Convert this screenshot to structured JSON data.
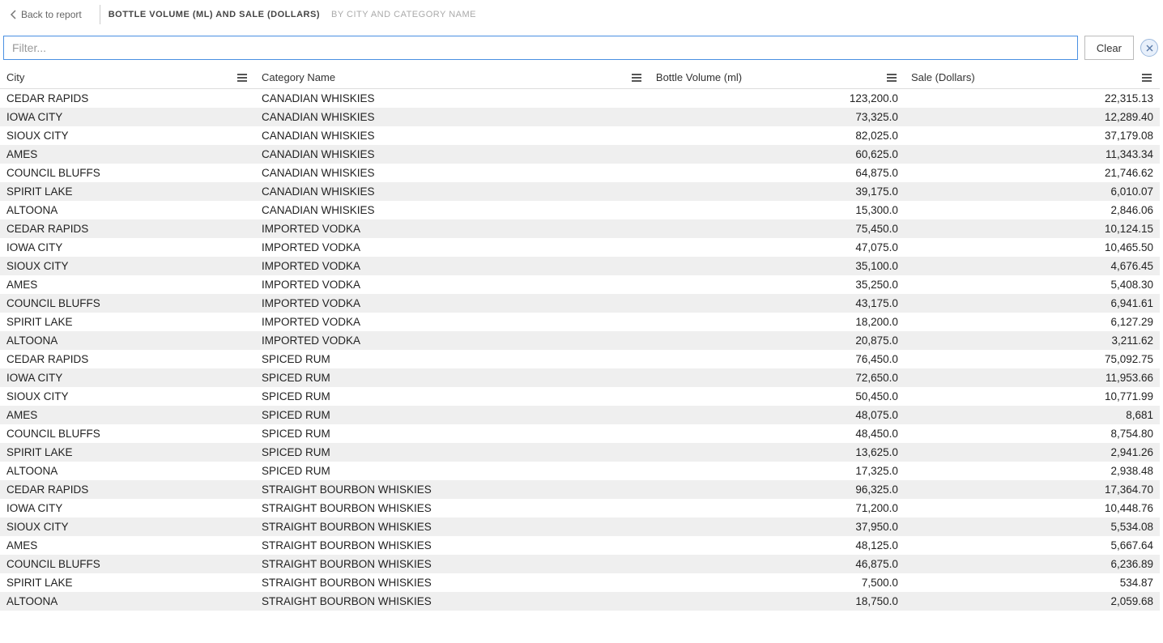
{
  "header": {
    "back_label": "Back to report",
    "title_main": "BOTTLE VOLUME (ML) AND SALE (DOLLARS)",
    "title_sub": "BY CITY AND CATEGORY NAME"
  },
  "filter": {
    "placeholder": "Filter...",
    "value": "",
    "clear_label": "Clear"
  },
  "table": {
    "columns": [
      {
        "label": "City",
        "align": "left"
      },
      {
        "label": "Category Name",
        "align": "left"
      },
      {
        "label": "Bottle Volume (ml)",
        "align": "right"
      },
      {
        "label": "Sale (Dollars)",
        "align": "right"
      }
    ],
    "rows": [
      {
        "city": "CEDAR RAPIDS",
        "category": "CANADIAN WHISKIES",
        "volume": "123,200.0",
        "sale": "22,315.13"
      },
      {
        "city": "IOWA CITY",
        "category": "CANADIAN WHISKIES",
        "volume": "73,325.0",
        "sale": "12,289.40"
      },
      {
        "city": "SIOUX CITY",
        "category": "CANADIAN WHISKIES",
        "volume": "82,025.0",
        "sale": "37,179.08"
      },
      {
        "city": "AMES",
        "category": "CANADIAN WHISKIES",
        "volume": "60,625.0",
        "sale": "11,343.34"
      },
      {
        "city": "COUNCIL BLUFFS",
        "category": "CANADIAN WHISKIES",
        "volume": "64,875.0",
        "sale": "21,746.62"
      },
      {
        "city": "SPIRIT LAKE",
        "category": "CANADIAN WHISKIES",
        "volume": "39,175.0",
        "sale": "6,010.07"
      },
      {
        "city": "ALTOONA",
        "category": "CANADIAN WHISKIES",
        "volume": "15,300.0",
        "sale": "2,846.06"
      },
      {
        "city": "CEDAR RAPIDS",
        "category": "IMPORTED VODKA",
        "volume": "75,450.0",
        "sale": "10,124.15"
      },
      {
        "city": "IOWA CITY",
        "category": "IMPORTED VODKA",
        "volume": "47,075.0",
        "sale": "10,465.50"
      },
      {
        "city": "SIOUX CITY",
        "category": "IMPORTED VODKA",
        "volume": "35,100.0",
        "sale": "4,676.45"
      },
      {
        "city": "AMES",
        "category": "IMPORTED VODKA",
        "volume": "35,250.0",
        "sale": "5,408.30"
      },
      {
        "city": "COUNCIL BLUFFS",
        "category": "IMPORTED VODKA",
        "volume": "43,175.0",
        "sale": "6,941.61"
      },
      {
        "city": "SPIRIT LAKE",
        "category": "IMPORTED VODKA",
        "volume": "18,200.0",
        "sale": "6,127.29"
      },
      {
        "city": "ALTOONA",
        "category": "IMPORTED VODKA",
        "volume": "20,875.0",
        "sale": "3,211.62"
      },
      {
        "city": "CEDAR RAPIDS",
        "category": "SPICED RUM",
        "volume": "76,450.0",
        "sale": "75,092.75"
      },
      {
        "city": "IOWA CITY",
        "category": "SPICED RUM",
        "volume": "72,650.0",
        "sale": "11,953.66"
      },
      {
        "city": "SIOUX CITY",
        "category": "SPICED RUM",
        "volume": "50,450.0",
        "sale": "10,771.99"
      },
      {
        "city": "AMES",
        "category": "SPICED RUM",
        "volume": "48,075.0",
        "sale": "8,681"
      },
      {
        "city": "COUNCIL BLUFFS",
        "category": "SPICED RUM",
        "volume": "48,450.0",
        "sale": "8,754.80"
      },
      {
        "city": "SPIRIT LAKE",
        "category": "SPICED RUM",
        "volume": "13,625.0",
        "sale": "2,941.26"
      },
      {
        "city": "ALTOONA",
        "category": "SPICED RUM",
        "volume": "17,325.0",
        "sale": "2,938.48"
      },
      {
        "city": "CEDAR RAPIDS",
        "category": "STRAIGHT BOURBON WHISKIES",
        "volume": "96,325.0",
        "sale": "17,364.70"
      },
      {
        "city": "IOWA CITY",
        "category": "STRAIGHT BOURBON WHISKIES",
        "volume": "71,200.0",
        "sale": "10,448.76"
      },
      {
        "city": "SIOUX CITY",
        "category": "STRAIGHT BOURBON WHISKIES",
        "volume": "37,950.0",
        "sale": "5,534.08"
      },
      {
        "city": "AMES",
        "category": "STRAIGHT BOURBON WHISKIES",
        "volume": "48,125.0",
        "sale": "5,667.64"
      },
      {
        "city": "COUNCIL BLUFFS",
        "category": "STRAIGHT BOURBON WHISKIES",
        "volume": "46,875.0",
        "sale": "6,236.89"
      },
      {
        "city": "SPIRIT LAKE",
        "category": "STRAIGHT BOURBON WHISKIES",
        "volume": "7,500.0",
        "sale": "534.87"
      },
      {
        "city": "ALTOONA",
        "category": "STRAIGHT BOURBON WHISKIES",
        "volume": "18,750.0",
        "sale": "2,059.68"
      }
    ]
  }
}
